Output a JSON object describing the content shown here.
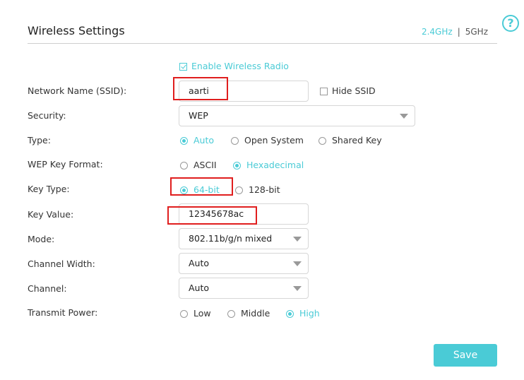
{
  "page": {
    "title": "Wireless Settings",
    "bands": [
      {
        "label": "2.4GHz",
        "active": true
      },
      {
        "label": "5GHz",
        "active": false
      }
    ],
    "band_separator": "|",
    "help_glyph": "?"
  },
  "enable_radio": {
    "label": "Enable Wireless Radio",
    "checked": true
  },
  "ssid": {
    "label": "Network Name (SSID):",
    "value": "aarti",
    "hide_label": "Hide SSID",
    "hide_checked": false
  },
  "security": {
    "label": "Security:",
    "value": "WEP"
  },
  "type": {
    "label": "Type:",
    "options": [
      "Auto",
      "Open System",
      "Shared Key"
    ],
    "selected": "Auto"
  },
  "wep_key_format": {
    "label": "WEP Key Format:",
    "options": [
      "ASCII",
      "Hexadecimal"
    ],
    "selected": "Hexadecimal"
  },
  "key_type": {
    "label": "Key Type:",
    "options": [
      "64-bit",
      "128-bit"
    ],
    "selected": "64-bit"
  },
  "key_value": {
    "label": "Key Value:",
    "value": "12345678ac"
  },
  "mode": {
    "label": "Mode:",
    "value": "802.11b/g/n mixed"
  },
  "channel_width": {
    "label": "Channel Width:",
    "value": "Auto"
  },
  "channel": {
    "label": "Channel:",
    "value": "Auto"
  },
  "transmit_power": {
    "label": "Transmit Power:",
    "options": [
      "Low",
      "Middle",
      "High"
    ],
    "selected": "High"
  },
  "save_label": "Save",
  "colors": {
    "accent": "#4acbd6",
    "highlight": "#e01e1e"
  }
}
